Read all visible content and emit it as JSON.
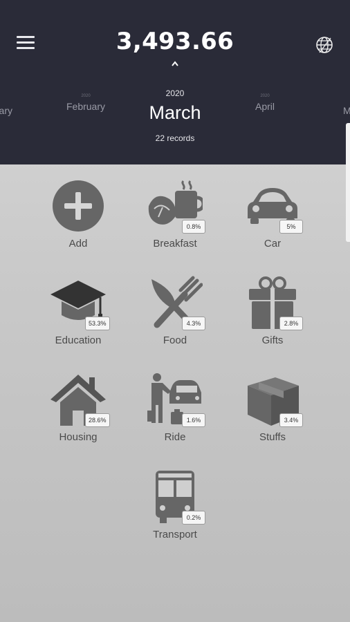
{
  "header": {
    "total": "3,493.66",
    "icons": {
      "menu": "menu-icon",
      "caret": "chevron-up-icon",
      "globe": "globe-icon"
    }
  },
  "months": {
    "prev2": {
      "name": "ary"
    },
    "prev1": {
      "year": "2020",
      "name": "February"
    },
    "current": {
      "year": "2020",
      "name": "March",
      "records": "22 records"
    },
    "next1": {
      "year": "2020",
      "name": "April"
    },
    "next2": {
      "name": "M"
    }
  },
  "categories": [
    {
      "label": "Add",
      "icon": "plus-circle-icon"
    },
    {
      "label": "Breakfast",
      "icon": "coffee-croissant-icon",
      "percent": "0.8%"
    },
    {
      "label": "Car",
      "icon": "car-icon",
      "percent": "5%"
    },
    {
      "label": "Education",
      "icon": "graduation-cap-icon",
      "percent": "53.3%"
    },
    {
      "label": "Food",
      "icon": "knife-fork-icon",
      "percent": "4.3%"
    },
    {
      "label": "Gifts",
      "icon": "gift-icon",
      "percent": "2.8%"
    },
    {
      "label": "Housing",
      "icon": "house-icon",
      "percent": "28.6%"
    },
    {
      "label": "Ride",
      "icon": "taxi-traveler-icon",
      "percent": "1.6%"
    },
    {
      "label": "Stuffs",
      "icon": "box-icon",
      "percent": "3.4%"
    },
    {
      "label": "Transport",
      "icon": "bus-icon",
      "percent": "0.2%"
    }
  ],
  "colors": {
    "header_bg": "#2a2b38",
    "icon_gray": "#666666",
    "body_bg": "#cccccc"
  }
}
